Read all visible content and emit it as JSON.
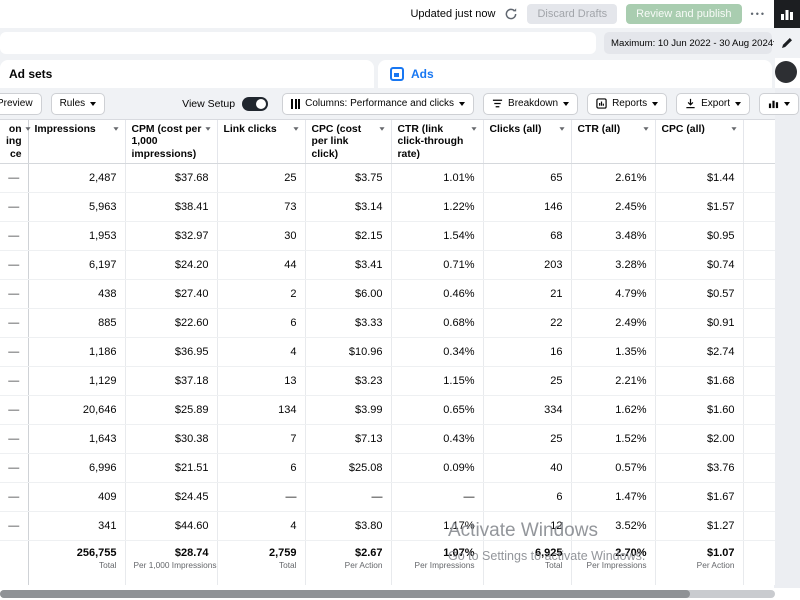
{
  "header_bar": {
    "updated_text": "Updated just now",
    "discard_label": "Discard Drafts",
    "review_label": "Review and publish",
    "more_label": "•••"
  },
  "search": {
    "value": "",
    "placeholder": ""
  },
  "date_filter": {
    "label": "Maximum: 10 Jun 2022 - 30 Aug 2024"
  },
  "tabs": {
    "adsets_label": "Ad sets",
    "ads_label": "Ads"
  },
  "toolbar": {
    "preview_label": "Preview",
    "rules_label": "Rules",
    "view_setup_label": "View Setup",
    "columns_label": "Columns: Performance and clicks",
    "breakdown_label": "Breakdown",
    "reports_label": "Reports",
    "export_label": "Export"
  },
  "table": {
    "columns": [
      {
        "label": "on\ning\nce",
        "truncated": true
      },
      {
        "label": "Impressions"
      },
      {
        "label": "CPM (cost per 1,000 impressions)"
      },
      {
        "label": "Link clicks"
      },
      {
        "label": "CPC (cost per link click)"
      },
      {
        "label": "CTR (link click-through rate)"
      },
      {
        "label": "Clicks (all)"
      },
      {
        "label": "CTR (all)"
      },
      {
        "label": "CPC (all)"
      },
      {
        "label": ""
      }
    ],
    "rows": [
      [
        "—",
        "2,487",
        "$37.68",
        "25",
        "$3.75",
        "1.01%",
        "65",
        "2.61%",
        "$1.44",
        ""
      ],
      [
        "—",
        "5,963",
        "$38.41",
        "73",
        "$3.14",
        "1.22%",
        "146",
        "2.45%",
        "$1.57",
        ""
      ],
      [
        "—",
        "1,953",
        "$32.97",
        "30",
        "$2.15",
        "1.54%",
        "68",
        "3.48%",
        "$0.95",
        ""
      ],
      [
        "—",
        "6,197",
        "$24.20",
        "44",
        "$3.41",
        "0.71%",
        "203",
        "3.28%",
        "$0.74",
        ""
      ],
      [
        "—",
        "438",
        "$27.40",
        "2",
        "$6.00",
        "0.46%",
        "21",
        "4.79%",
        "$0.57",
        ""
      ],
      [
        "—",
        "885",
        "$22.60",
        "6",
        "$3.33",
        "0.68%",
        "22",
        "2.49%",
        "$0.91",
        ""
      ],
      [
        "—",
        "1,186",
        "$36.95",
        "4",
        "$10.96",
        "0.34%",
        "16",
        "1.35%",
        "$2.74",
        ""
      ],
      [
        "—",
        "1,129",
        "$37.18",
        "13",
        "$3.23",
        "1.15%",
        "25",
        "2.21%",
        "$1.68",
        ""
      ],
      [
        "—",
        "20,646",
        "$25.89",
        "134",
        "$3.99",
        "0.65%",
        "334",
        "1.62%",
        "$1.60",
        ""
      ],
      [
        "—",
        "1,643",
        "$30.38",
        "7",
        "$7.13",
        "0.43%",
        "25",
        "1.52%",
        "$2.00",
        ""
      ],
      [
        "—",
        "6,996",
        "$21.51",
        "6",
        "$25.08",
        "0.09%",
        "40",
        "0.57%",
        "$3.76",
        ""
      ],
      [
        "—",
        "409",
        "$24.45",
        "—",
        "—",
        "—",
        "6",
        "1.47%",
        "$1.67",
        ""
      ],
      [
        "—",
        "341",
        "$44.60",
        "4",
        "$3.80",
        "1.17%",
        "12",
        "3.52%",
        "$1.27",
        ""
      ]
    ],
    "totals": [
      {
        "value": "",
        "caption": ""
      },
      {
        "value": "256,755",
        "caption": "Total"
      },
      {
        "value": "$28.74",
        "caption": "Per 1,000 Impressions"
      },
      {
        "value": "2,759",
        "caption": "Total"
      },
      {
        "value": "$2.67",
        "caption": "Per Action"
      },
      {
        "value": "1.07%",
        "caption": "Per Impressions"
      },
      {
        "value": "6,925",
        "caption": "Total"
      },
      {
        "value": "2.70%",
        "caption": "Per Impressions"
      },
      {
        "value": "$1.07",
        "caption": "Per Action"
      },
      {
        "value": "",
        "caption": ""
      }
    ]
  },
  "watermark": {
    "line1": "Activate Windows",
    "line2": "Go to Settings to activate Windows."
  }
}
